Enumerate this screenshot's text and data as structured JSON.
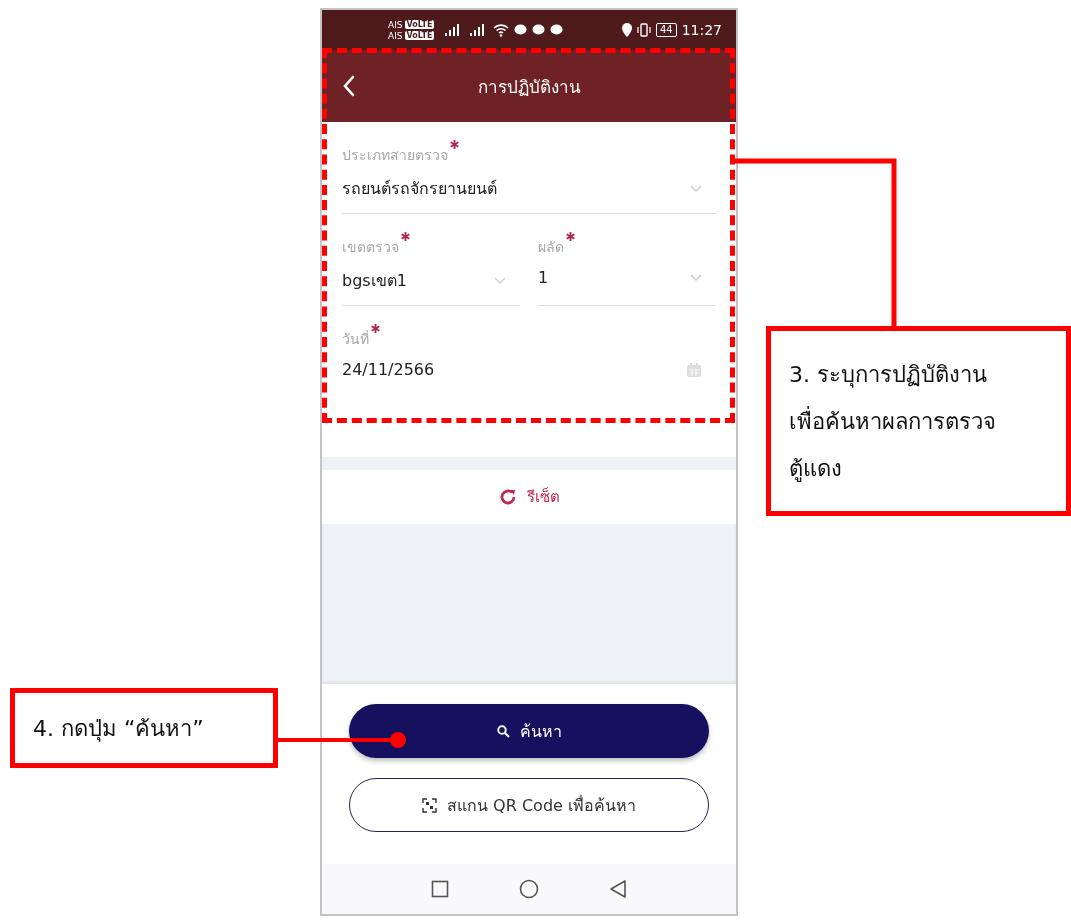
{
  "status_bar": {
    "carriers": [
      "AIS",
      "AIS"
    ],
    "network_badges": [
      "VoLTE",
      "VoLTE"
    ],
    "battery": "44",
    "time": "11:27"
  },
  "app_bar": {
    "title": "การปฏิบัติงาน"
  },
  "form": {
    "rows": [
      [
        {
          "label": "ประเภทสายตรวจ",
          "required": true,
          "value": "รถยนต์รถจักรยานยนต์",
          "kind": "select"
        }
      ],
      [
        {
          "label": "เขตตรวจ",
          "required": true,
          "value": "bgsเขต1",
          "kind": "select"
        },
        {
          "label": "ผลัด",
          "required": true,
          "value": "1",
          "kind": "select"
        }
      ],
      [
        {
          "label": "วันที่",
          "required": true,
          "value": "24/11/2566",
          "kind": "date"
        }
      ]
    ]
  },
  "reset_button": {
    "label": "รีเซ็ต"
  },
  "search_button": {
    "label": "ค้นหา"
  },
  "scan_button": {
    "label": "สแกน QR Code เพื่อค้นหา"
  },
  "annotations": [
    {
      "kind": "region",
      "lines": [
        "3. ระบุการปฏิบัติงาน",
        "เพื่อค้นหาผลการตรวจ",
        "ตู้แดง"
      ]
    },
    {
      "kind": "pointer",
      "lines": [
        "4. กดปุ่ม “ค้นหา”"
      ]
    }
  ]
}
